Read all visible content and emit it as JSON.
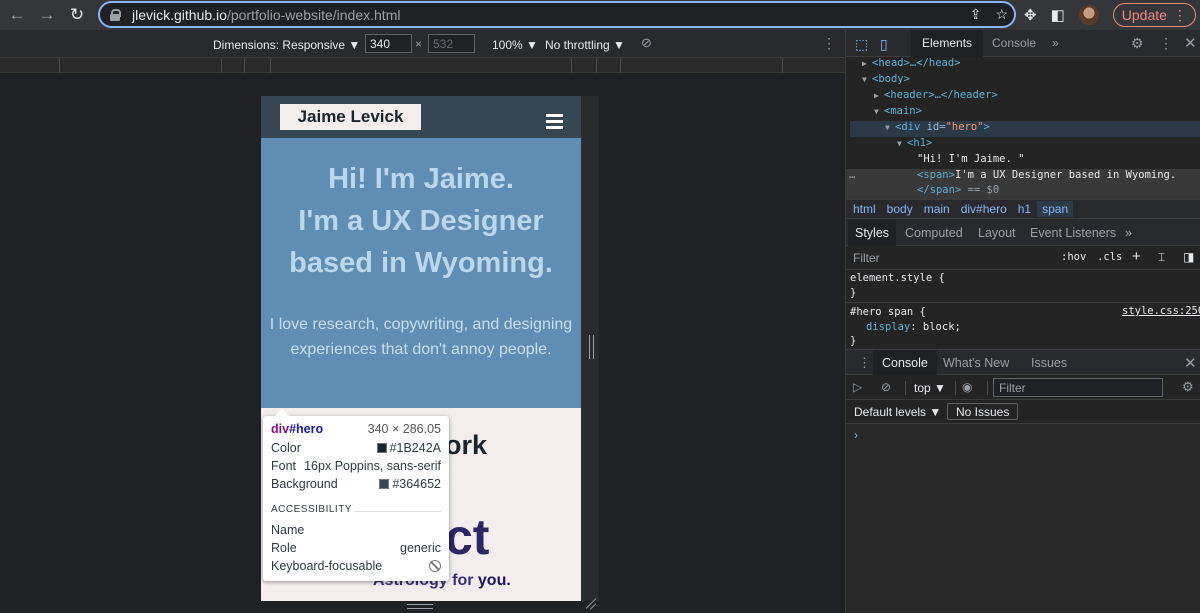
{
  "browser": {
    "url_host": "jlevick.github.io",
    "url_path": "/portfolio-website/index.html",
    "update_label": "Update"
  },
  "device_toolbar": {
    "dimensions_label": "Dimensions: Responsive ▼",
    "width": "340",
    "times": "×",
    "height_placeholder": "532",
    "zoom": "100% ▼",
    "throttling": "No throttling ▼"
  },
  "site": {
    "logo": "Jaime Levick",
    "hero_line1": "Hi! I'm Jaime.",
    "hero_line2": "I'm a UX Designer",
    "hero_line3": "based in Wyoming.",
    "hero_paragraph": "I love research, copywriting, and designing experiences that don't annoy people.",
    "fragment_ork": "ork",
    "fragment_ct": "ct",
    "fragment_astro_pre": "Astrology for ",
    "fragment_astro_bold": "you."
  },
  "tooltip": {
    "tag": "div",
    "id": "#hero",
    "dimensions": "340 × 286.05",
    "rows": [
      {
        "label": "Color",
        "value": "#1B242A",
        "swatch": "#1B242A"
      },
      {
        "label": "Font",
        "value": "16px Poppins, sans-serif"
      },
      {
        "label": "Background",
        "value": "#364652",
        "swatch": "#364652"
      }
    ],
    "accessibility_heading": "ACCESSIBILITY",
    "acc_rows": [
      {
        "label": "Name",
        "value": ""
      },
      {
        "label": "Role",
        "value": "generic"
      },
      {
        "label": "Keyboard-focusable",
        "value": ""
      }
    ]
  },
  "devtools": {
    "tabs": [
      "Elements",
      "Console",
      "»"
    ],
    "dom": {
      "head": "<head>…</head>",
      "body": "<body>",
      "header": "<header>…</header>",
      "main": "<main>",
      "div_open": "<div ",
      "div_attr": "id=",
      "div_val": "\"hero\"",
      "div_close": ">",
      "h1": "<h1>",
      "text": "\"Hi! I'm Jaime. \"",
      "span_open": "<span>",
      "span_text": "I'm a UX Designer based in Wyoming.",
      "span_close": "</span>",
      "eq": " == $0",
      "ellipsis": "…"
    },
    "breadcrumbs": [
      "html",
      "body",
      "main",
      "div#hero",
      "h1",
      "span"
    ],
    "sub_tabs": [
      "Styles",
      "Computed",
      "Layout",
      "Event Listeners",
      "»"
    ],
    "filter_placeholder": "Filter",
    "hov": ":hov",
    "cls": ".cls",
    "rules": {
      "element_style": "element.style {",
      "close_brace": "}",
      "selector": "#hero span {",
      "source": "style.css:250",
      "prop_name": "display",
      "prop_value": ": block;"
    },
    "drawer_tabs": [
      "Console",
      "What's New",
      "Issues"
    ],
    "context": "top ▼",
    "console_filter": "Filter",
    "levels": "Default levels ▼",
    "no_issues": "No Issues",
    "prompt": "›"
  }
}
